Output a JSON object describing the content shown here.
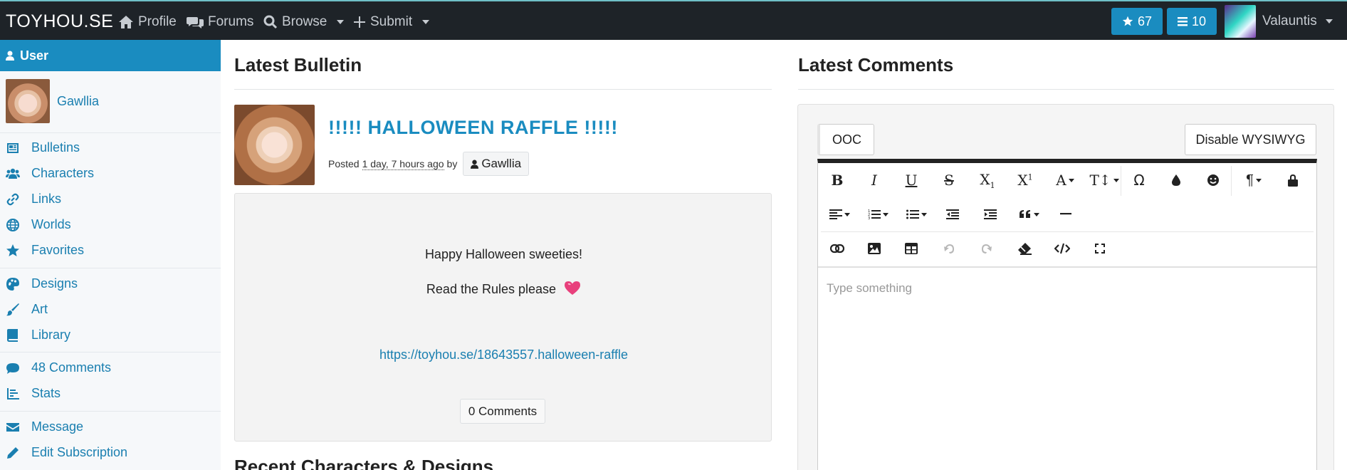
{
  "nav": {
    "brand": "TOYHOU.SE",
    "links": [
      "Profile",
      "Forums",
      "Browse",
      "Submit"
    ],
    "stars": "67",
    "lists": "10",
    "username": "Valauntis"
  },
  "sidebar": {
    "header": "User",
    "user": "Gawllia",
    "items": [
      "Bulletins",
      "Characters",
      "Links",
      "Worlds",
      "Favorites",
      "Designs",
      "Art",
      "Library",
      "48 Comments",
      "Stats",
      "Message",
      "Edit Subscription"
    ]
  },
  "bulletin": {
    "section_title": "Latest Bulletin",
    "title": "!!!!! HALLOWEEN RAFFLE !!!!!",
    "posted_label": "Posted",
    "posted_time": "1 day, 7 hours ago",
    "by_label": "by",
    "author": "Gawllia",
    "line1": "Happy Halloween sweeties!",
    "line2": "Read the Rules please",
    "link": "https://toyhou.se/18643557.halloween-raffle",
    "comments_button": "0 Comments",
    "next_section": "Recent Characters & Designs"
  },
  "comments": {
    "section_title": "Latest Comments",
    "ooc_label": "OOC",
    "disable_button": "Disable WYSIWYG",
    "placeholder": "Type something"
  },
  "colors": {
    "accent": "#1a8cc0",
    "navbar": "#1e2328",
    "heart": "#e8407c"
  }
}
